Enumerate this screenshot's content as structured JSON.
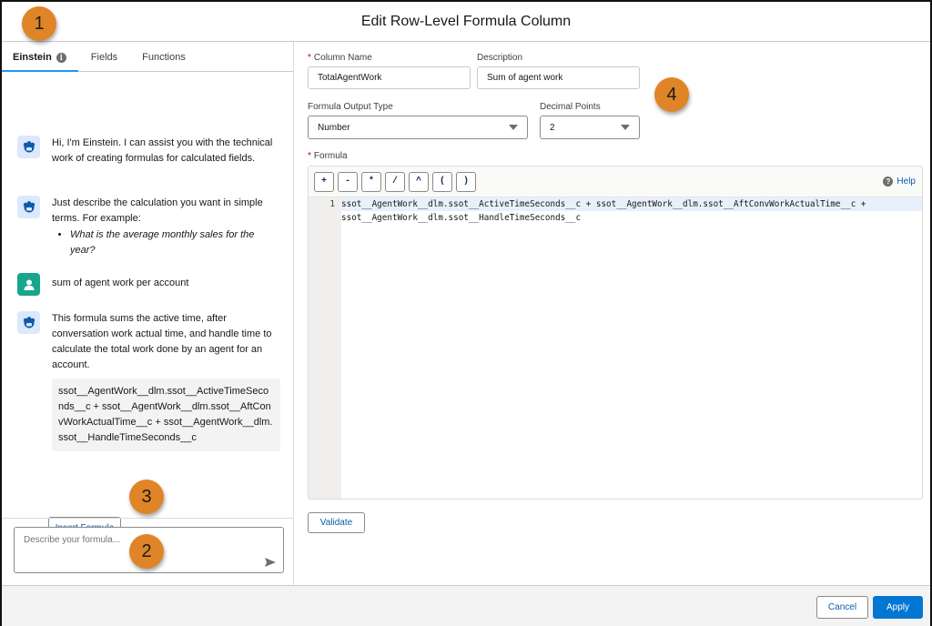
{
  "dialog": {
    "title": "Edit Row-Level Formula Column"
  },
  "left_panel": {
    "tabs": [
      {
        "label": "Einstein",
        "active": true,
        "icon": "info-icon"
      },
      {
        "label": "Fields",
        "active": false
      },
      {
        "label": "Functions",
        "active": false
      }
    ],
    "messages": [
      {
        "sender": "einstein",
        "icon": "einstein-bot-icon",
        "text": "Hi, I'm Einstein. I can assist you with the technical work of creating formulas for calculated fields."
      },
      {
        "sender": "einstein",
        "icon": "einstein-bot-icon",
        "text": "Just describe the calculation you want in simple terms. For example:",
        "bullet": "What is the average monthly sales for the year?"
      },
      {
        "sender": "user",
        "icon": "user-icon",
        "text": "sum of agent work per account"
      },
      {
        "sender": "einstein",
        "icon": "einstein-bot-icon",
        "text": "This formula sums the active time, after conversation work actual time, and handle time to calculate the total work done by an agent for an account.",
        "code": "ssot__AgentWork__dlm.ssot__ActiveTimeSeconds__c + ssot__AgentWork__dlm.ssot__AftConvWorkActualTime__c + ssot__AgentWork__dlm.ssot__HandleTimeSeconds__c"
      }
    ],
    "insert_formula_label": "Insert Formula",
    "prompt_placeholder": "Describe your formula...",
    "send_icon": "send-icon"
  },
  "form": {
    "column_name": {
      "label": "Column Name",
      "required": true,
      "value": "TotalAgentWork"
    },
    "description": {
      "label": "Description",
      "required": false,
      "value": "Sum of agent work"
    },
    "output_type": {
      "label": "Formula Output Type",
      "value": "Number"
    },
    "decimal_points": {
      "label": "Decimal Points",
      "value": "2"
    },
    "formula": {
      "label": "Formula",
      "required": true,
      "operators": [
        "+",
        "-",
        "*",
        "/",
        "^",
        "(",
        ")"
      ],
      "help_label": "Help",
      "line_number": "1",
      "lines": [
        "ssot__AgentWork__dlm.ssot__ActiveTimeSeconds__c + ssot__AgentWork__dlm.ssot__AftConvWorkActualTime__c +",
        "ssot__AgentWork__dlm.ssot__HandleTimeSeconds__c"
      ]
    },
    "validate_label": "Validate"
  },
  "footer": {
    "cancel_label": "Cancel",
    "apply_label": "Apply"
  },
  "callouts": [
    "1",
    "2",
    "3",
    "4"
  ],
  "colors": {
    "brand": "#0176d3",
    "link": "#0b5cab",
    "tab_underline": "#1b96ff",
    "callout": "#e08527",
    "user_avatar": "#18a58d",
    "bot_avatar_bg": "#dce8fb",
    "required": "#ba0517"
  }
}
